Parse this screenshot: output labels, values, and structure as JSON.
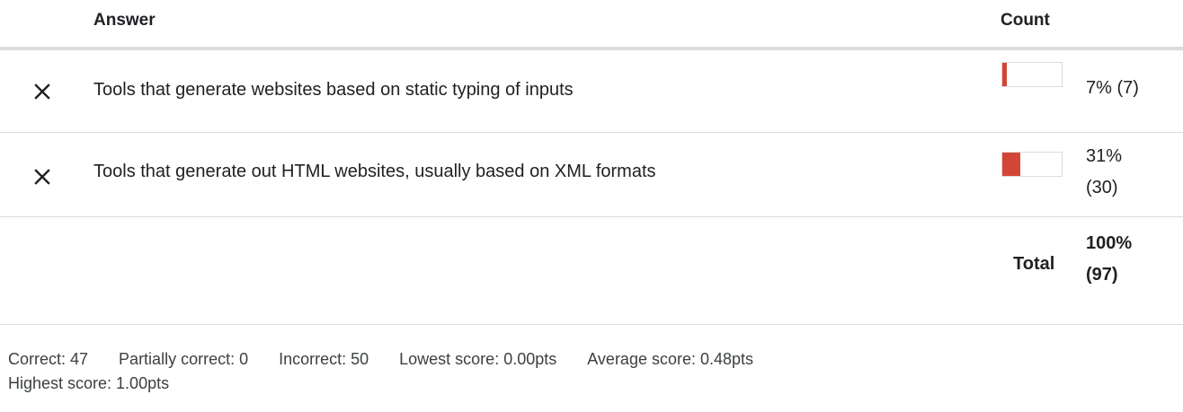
{
  "header": {
    "answer_label": "Answer",
    "count_label": "Count"
  },
  "rows": [
    {
      "mark": "close-icon",
      "answer": "Tools that generate websites based on static typing of inputs",
      "percent": 7,
      "count_text": "7% (7)"
    },
    {
      "mark": "close-icon",
      "answer": "Tools that generate out HTML websites, usually based on XML formats",
      "percent": 31,
      "count_text_line1": "31%",
      "count_text_line2": "(30)"
    }
  ],
  "total": {
    "label": "Total",
    "line1": "100%",
    "line2": "(97)"
  },
  "stats": {
    "correct": "Correct: 47",
    "partially_correct": "Partially correct: 0",
    "incorrect": "Incorrect: 50",
    "lowest": "Lowest score: 0.00pts",
    "average": "Average score: 0.48pts",
    "highest": "Highest score: 1.00pts"
  },
  "colors": {
    "bar_fill": "#d34637",
    "bar_border": "#dadce0",
    "divider": "#dcdcdc"
  }
}
